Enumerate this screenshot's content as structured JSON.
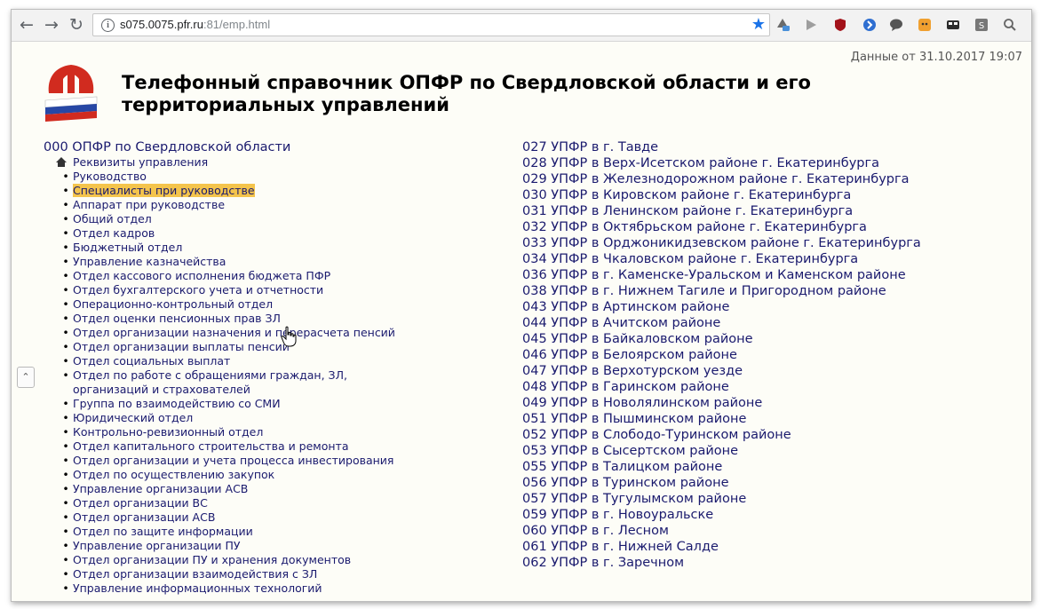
{
  "browser": {
    "url_host": "s075.0075.pfr.ru",
    "url_port": ":81",
    "url_path": "/emp.html",
    "icons": {
      "back": "arrow-left-icon",
      "forward": "arrow-right-icon",
      "reload": "reload-icon",
      "star": "bookmark-star-icon"
    },
    "colors": {
      "accent": "#1a73e8"
    }
  },
  "page": {
    "date_line": "Данные от 31.10.2017 19:07",
    "title": "Телефонный справочник ОПФР по Свердловской области и его территориальных управлений",
    "colors": {
      "link": "#1a1a6e",
      "highlight": "#f4c44c",
      "background": "#fdfdf7"
    },
    "left": {
      "root": "000 ОПФР по Свердловской области",
      "items": [
        "Реквизиты управления",
        "Руководство",
        "Специалисты при руководстве",
        "Аппарат при руководстве",
        "Общий отдел",
        "Отдел кадров",
        "Бюджетный отдел",
        "Управление казначейства",
        "Отдел кассового исполнения бюджета ПФР",
        "Отдел бухгалтерского учета и отчетности",
        "Операционно-контрольный отдел",
        "Отдел оценки пенсионных прав ЗЛ",
        "Отдел организации назначения и перерасчета пенсий",
        "Отдел организации выплаты пенсий",
        "Отдел социальных выплат",
        "Отдел по работе с обращениями граждан, ЗЛ,",
        "организаций и страхователей",
        "Группа по взаимодействию со СМИ",
        "Юридический отдел",
        "Контрольно-ревизионный отдел",
        "Отдел капитального строительства и ремонта",
        "Отдел организации и учета процесса инвестирования",
        "Отдел по осуществлению закупок",
        "Управление организации АСВ",
        "Отдел организации ВС",
        "Отдел организации АСВ",
        "Отдел по защите информации",
        "Управление организации ПУ",
        "Отдел организации ПУ и хранения документов",
        "Отдел организации взаимодействия с ЗЛ",
        "Управление информационных технологий"
      ]
    },
    "right": {
      "items": [
        "027 УПФР в г. Тавде",
        "028 УПФР в Верх-Исетском районе г. Екатеринбурга",
        "029 УПФР в Железнодорожном районе г. Екатеринбурга",
        "030 УПФР в Кировском районе г. Екатеринбурга",
        "031 УПФР в Ленинском районе г. Екатеринбурга",
        "032 УПФР в Октябрьском районе г. Екатеринбурга",
        "033 УПФР в Орджоникидзевском районе г. Екатеринбурга",
        "034 УПФР в Чкаловском районе г. Екатеринбурга",
        "036 УПФР в г. Каменске-Уральском и Каменском районе",
        "038 УПФР в г. Нижнем Тагиле и Пригородном районе",
        "043 УПФР в Артинском районе",
        "044 УПФР в Ачитском районе",
        "045 УПФР в Байкаловском районе",
        "046 УПФР в Белоярском районе",
        "047 УПФР в Верхотурском уезде",
        "048 УПФР в Гаринском районе",
        "049 УПФР в Новолялинском районе",
        "051 УПФР в Пышминском районе",
        "052 УПФР в Слободо-Туринском районе",
        "053 УПФР в Сысертском районе",
        "055 УПФР в Талицком районе",
        "056 УПФР в Туринском районе",
        "057 УПФР в Тугулымском районе",
        "059 УПФР в г. Новоуральске",
        "060 УПФР в г. Лесном",
        "061 УПФР в г. Нижней Салде",
        "062 УПФР в г. Заречном"
      ]
    }
  }
}
